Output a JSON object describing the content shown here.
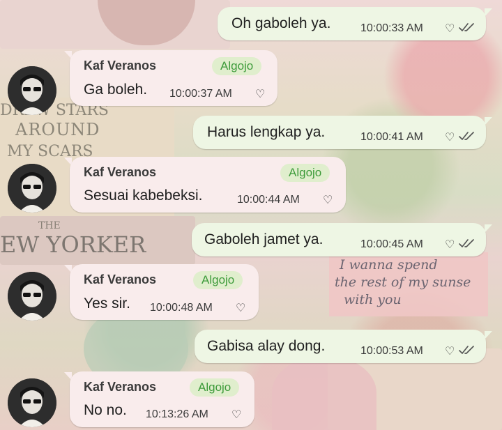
{
  "wallpaper": {
    "text_around": "AROUND",
    "text_drew": "DREW STARS",
    "text_scars": "MY SCARS",
    "text_the": "THE",
    "text_yorker": "EW YORKER",
    "note_line1": "I wanna spend",
    "note_line2": "the rest of my sunse",
    "note_line3": "with you"
  },
  "colors": {
    "outgoing_bubble": "#eef6e4",
    "incoming_bubble": "#f9ecec",
    "badge_bg": "#e0eecd",
    "badge_text": "#3d9b3a",
    "read_ticks": "#555555"
  },
  "heart_icon": "♡",
  "messages": [
    {
      "direction": "out",
      "text": "Oh gaboleh ya.",
      "time": "10:00:33 AM",
      "icon": "double-check-icon"
    },
    {
      "direction": "in",
      "sender": "Kaf Veranos",
      "badge": "Algojo",
      "text": "Ga boleh.",
      "time": "10:00:37 AM"
    },
    {
      "direction": "out",
      "text": "Harus lengkap ya.",
      "time": "10:00:41 AM",
      "icon": "double-check-icon"
    },
    {
      "direction": "in",
      "sender": "Kaf Veranos",
      "badge": "Algojo",
      "text": "Sesuai kabebeksi.",
      "time": "10:00:44 AM"
    },
    {
      "direction": "out",
      "text": "Gaboleh jamet ya.",
      "time": "10:00:45 AM",
      "icon": "double-check-icon"
    },
    {
      "direction": "in",
      "sender": "Kaf Veranos",
      "badge": "Algojo",
      "text": "Yes sir.",
      "time": "10:00:48 AM"
    },
    {
      "direction": "out",
      "text": "Gabisa alay dong.",
      "time": "10:00:53 AM",
      "icon": "double-check-icon"
    },
    {
      "direction": "in",
      "sender": "Kaf Veranos",
      "badge": "Algojo",
      "text": "No no.",
      "time": "10:13:26 AM"
    }
  ]
}
